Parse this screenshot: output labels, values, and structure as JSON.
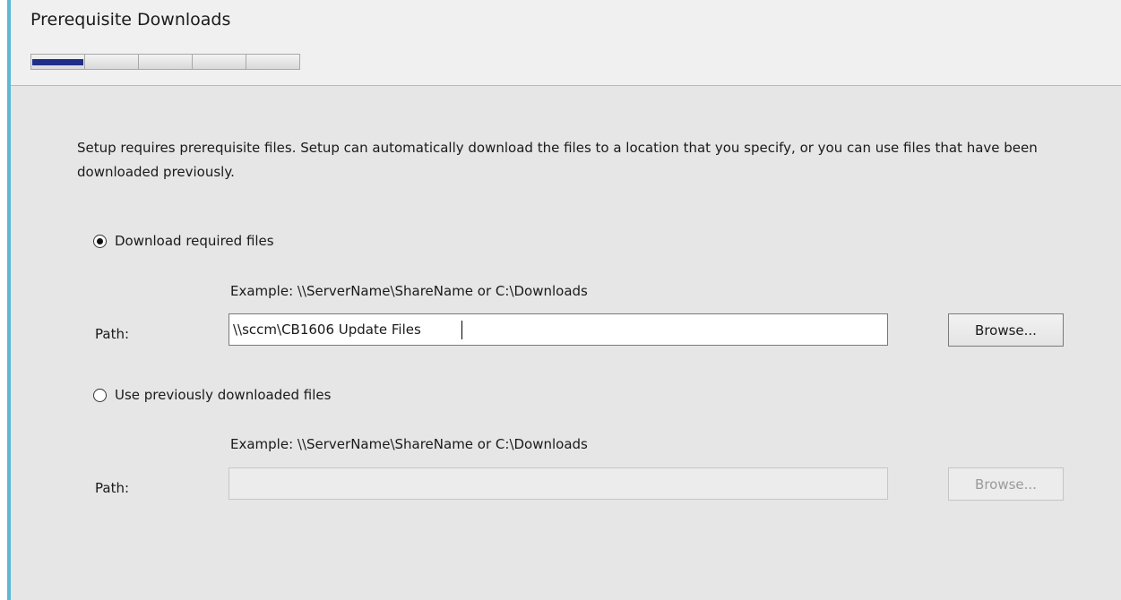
{
  "header": {
    "title": "Prerequisite Downloads",
    "progress": {
      "total_steps": 5,
      "current_step": 1
    }
  },
  "main": {
    "description": "Setup requires prerequisite files. Setup can automatically download the files to a location that you specify, or you can use files that have been downloaded previously.",
    "download_option": {
      "label": "Download required files",
      "selected": true,
      "example": "Example: \\\\ServerName\\ShareName or C:\\Downloads",
      "path_label": "Path:",
      "path_value": "\\\\sccm\\CB1606 Update Files",
      "browse_label": "Browse..."
    },
    "previous_option": {
      "label": "Use previously downloaded files",
      "selected": false,
      "example": "Example: \\\\ServerName\\ShareName or C:\\Downloads",
      "path_label": "Path:",
      "path_value": "",
      "browse_label": "Browse...",
      "enabled": false
    }
  },
  "colors": {
    "accent": "#5bb8d6",
    "progress_active": "#1e2f8a",
    "background": "#e6e6e6",
    "header_background": "#f0f0f0"
  }
}
